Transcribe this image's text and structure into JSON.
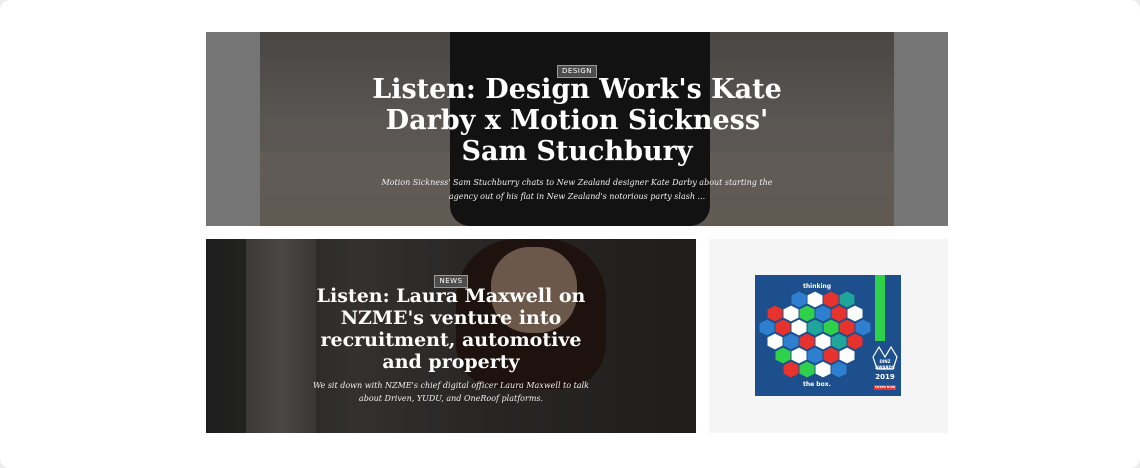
{
  "hero": {
    "tag": "DESIGN",
    "title": "Listen: Design Work's Kate Darby x Motion Sickness' Sam Stuchbury",
    "excerpt": "Motion Sickness' Sam Stuchburry chats to New Zealand designer Kate Darby about starting the agency out of his flat in New Zealand's notorious party slash ..."
  },
  "news": {
    "tag": "NEWS",
    "title": "Listen: Laura Maxwell on NZME's venture into recruitment, automotive and property",
    "excerpt": "We sit down with NZME's chief digital officer Laura Maxwell to talk about Driven, YUDU, and OneRoof platforms."
  },
  "ad": {
    "top_text": "thinking",
    "bottom_text": "the box.",
    "logo_line1": "DINZ",
    "logo_line2": "AWARDS",
    "year": "2019",
    "cta": "ENTER NOW",
    "colors": {
      "background": "#1d4f8c",
      "green": "#2fd14a",
      "red": "#e8322d"
    }
  }
}
